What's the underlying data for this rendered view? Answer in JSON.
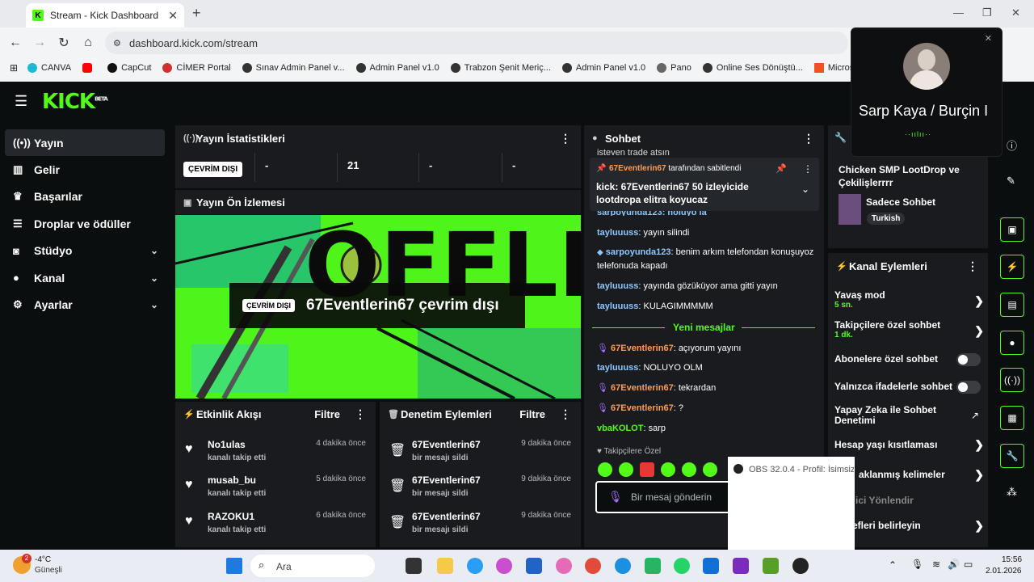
{
  "browser": {
    "tab_title": "Stream - Kick Dashboard",
    "url": "dashboard.kick.com/stream",
    "bookmarks": [
      "CANVA",
      "CapCut",
      "CİMER Portal",
      "Sınav Admin Panel v...",
      "Admin Panel v1.0",
      "Trabzon Şenit Meriç...",
      "Admin Panel v1.0",
      "Pano",
      "Online Ses Dönüştü...",
      "Microsoft hesabınız"
    ]
  },
  "logo": {
    "text": "KICK",
    "badge": "BETA"
  },
  "sidebar": {
    "items": [
      {
        "label": "Yayın",
        "icon": "broadcast-icon"
      },
      {
        "label": "Gelir",
        "icon": "chart-icon"
      },
      {
        "label": "Başarılar",
        "icon": "trophy-icon"
      },
      {
        "label": "Droplar ve ödüller",
        "icon": "gift-icon"
      },
      {
        "label": "Stüdyo",
        "icon": "camera-icon"
      },
      {
        "label": "Kanal",
        "icon": "user-icon"
      },
      {
        "label": "Ayarlar",
        "icon": "gear-icon"
      }
    ]
  },
  "stats": {
    "title": "Yayın İstatistikleri",
    "status_badge": "ÇEVRİM DIŞI",
    "values": [
      "-",
      "21",
      "-",
      "-"
    ]
  },
  "preview": {
    "title": "Yayın Ön İzlemesi",
    "badge": "ÇEVRİM DIŞI",
    "message": "67Eventlerin67 çevrim dışı",
    "bg_text": "OFFLINE"
  },
  "activity": {
    "title": "Etkinlik Akışı",
    "filter": "Filtre",
    "rows": [
      {
        "name": "No1ulas",
        "sub": "kanalı takip etti",
        "time": "4 dakika önce"
      },
      {
        "name": "musab_bu",
        "sub": "kanalı takip etti",
        "time": "5 dakika önce"
      },
      {
        "name": "RAZOKU1",
        "sub": "kanalı takip etti",
        "time": "6 dakika önce"
      }
    ]
  },
  "moderation": {
    "title": "Denetim Eylemleri",
    "filter": "Filtre",
    "rows": [
      {
        "name": "67Eventlerin67",
        "sub": "bir mesajı sildi",
        "time": "9 dakika önce"
      },
      {
        "name": "67Eventlerin67",
        "sub": "bir mesajı sildi",
        "time": "9 dakika önce"
      },
      {
        "name": "67Eventlerin67",
        "sub": "bir mesajı sildi",
        "time": "9 dakika önce"
      }
    ]
  },
  "chat": {
    "title": "Sohbet",
    "top_cut": "isteyen trade atsın",
    "pinned_by": "67Eventlerin67",
    "pinned_suffix": "tarafından sabitlendi",
    "pinned_text": "kick: 67Eventlerin67 50 izleyicide lootdropa elitra koyucaz",
    "behind_pin": "sarpoyunda123: noluyo la",
    "messages": [
      {
        "user": "tayluuuss",
        "text": "yayın silindi",
        "color": "blue"
      },
      {
        "user": "sarpoyunda123",
        "text": "benim arkım telefondan konuşuyoz telefonuda kapadı",
        "color": "blue",
        "badge": true
      },
      {
        "user": "tayluuuss",
        "text": "yayında gözüküyor ama gitti yayın",
        "color": "blue"
      },
      {
        "user": "tayluuuss",
        "text": "KULAGIMMMMM",
        "color": "blue"
      }
    ],
    "new_divider": "Yeni mesajlar",
    "new_messages": [
      {
        "user": "67Eventlerin67",
        "text": "açıyorum yayını",
        "color": "orange"
      },
      {
        "user": "tayluuuss",
        "text": "NOLUYO OLM",
        "color": "blue"
      },
      {
        "user": "67Eventlerin67",
        "text": "tekrardan",
        "color": "orange"
      },
      {
        "user": "67Eventlerin67",
        "text": "?",
        "color": "orange"
      },
      {
        "user": "vbaKOLOT",
        "text": "sarp",
        "color": "green"
      }
    ],
    "followers_only": "Takipçilere Özel",
    "input_placeholder": "Bir mesaj gönderin"
  },
  "stream_info": {
    "title": "Chicken SMP LootDrop ve Çekilişlerrrr",
    "category": "Sadece Sohbet",
    "tag": "Turkish"
  },
  "channel_actions": {
    "title": "Kanal Eylemleri",
    "rows": [
      {
        "label": "Yavaş mod",
        "sub": "5 sn.",
        "type": "arrow"
      },
      {
        "label": "Takipçilere özel sohbet",
        "sub": "1 dk.",
        "type": "arrow"
      },
      {
        "label": "Abonelere özel sohbet",
        "sub": "",
        "type": "toggle"
      },
      {
        "label": "Yalnızca ifadelerle sohbet",
        "sub": "",
        "type": "toggle"
      },
      {
        "label": "Yapay Zeka ile Sohbet Denetimi",
        "sub": "",
        "type": "external"
      },
      {
        "label": "Hesap yaşı kısıtlaması",
        "sub": "",
        "type": "arrow"
      },
      {
        "label": "aklanmış kelimeler",
        "sub": "",
        "type": "arrow"
      },
      {
        "label": "ici Yönlendir",
        "sub": "",
        "type": "none"
      },
      {
        "label": "efleri belirleyin",
        "sub": "",
        "type": "arrow"
      }
    ]
  },
  "call_popup": {
    "name": "Sarp Kaya / Burçin I"
  },
  "obs_popup": {
    "title": "OBS 32.0.4 - Profil: İsimsiz"
  },
  "taskbar": {
    "weather_temp": "-4°C",
    "weather_desc": "Güneşli",
    "weather_badge": "2",
    "search_placeholder": "Ara",
    "time": "15:56",
    "date": "2.01.2026"
  },
  "colors": {
    "accent": "#53fc18",
    "panel": "#191b1f",
    "background": "#0b0e0f"
  }
}
